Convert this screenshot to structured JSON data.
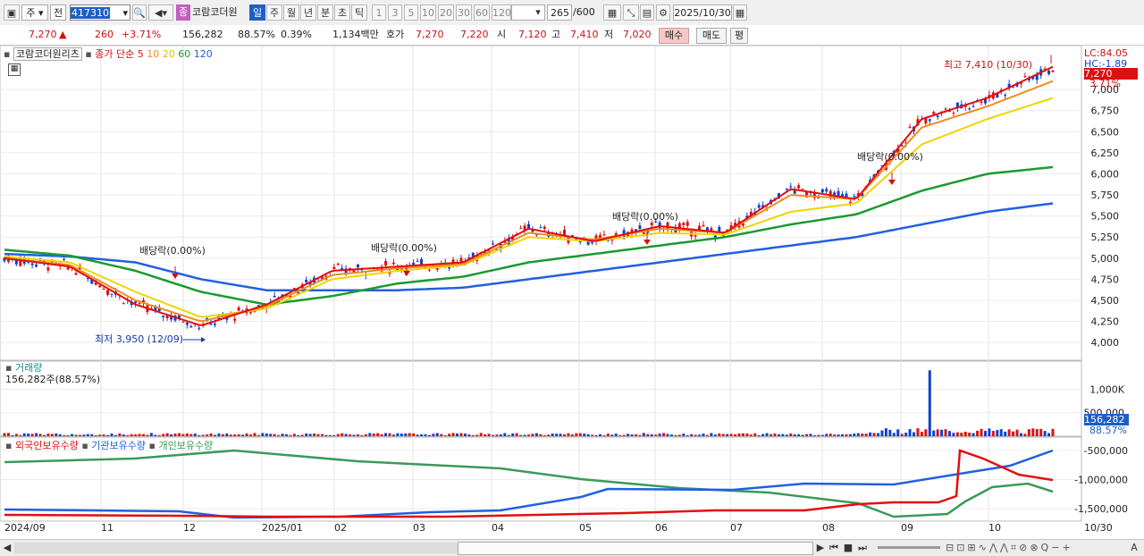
{
  "toolbar": {
    "chart_icon_label": "▣",
    "period_type": "주",
    "prev_label": "전",
    "code": "417310",
    "stock_type_badge": "종",
    "stock_name": "코람코더원",
    "periods": [
      "일",
      "주",
      "월",
      "년",
      "분",
      "초",
      "틱"
    ],
    "active_period": "일",
    "intervals": [
      "1",
      "3",
      "5",
      "10",
      "20",
      "30",
      "60",
      "120"
    ],
    "count_display": "265",
    "count_max": "/600",
    "date": "2025/10/30"
  },
  "quote": {
    "price": "7,270",
    "change_arrow": "▲",
    "change": "260",
    "change_pct": "+3.71%",
    "volume": "156,282",
    "vol_ratio": "88.57%",
    "turnover": "0.39%",
    "amount": "1,134백만",
    "bid_label": "호가",
    "bid1": "7,270",
    "bid2": "7,220",
    "open_label": "시",
    "open": "7,120",
    "high_label": "고",
    "high": "7,410",
    "low_label": "저",
    "low": "7,020",
    "buy_label": "매수",
    "sell_label": "매도",
    "avg_label": "평"
  },
  "legend_main": {
    "name": "코람코더원리츠",
    "price_type": "종가 단순",
    "ma": [
      {
        "label": "5",
        "color": "#e01010"
      },
      {
        "label": "10",
        "color": "#f08c1e"
      },
      {
        "label": "20",
        "color": "#f0d400"
      },
      {
        "label": "60",
        "color": "#1a9a30"
      },
      {
        "label": "120",
        "color": "#2060e0"
      }
    ]
  },
  "annotations": {
    "high": "최고 7,410 (10/30)",
    "low": "최저 3,950 (12/09)",
    "dividends": [
      "배당락(0.00%)",
      "배당락(0.00%)",
      "배당락(0.00%)",
      "배당락(0.00%)"
    ]
  },
  "right_labels": {
    "lc": "LC:84.05",
    "hc": "HC:-1.89",
    "price_tag": "7,270",
    "pct_tag": "3.71%",
    "vol_tag": "156,282",
    "vol_pct_tag": "88.57%"
  },
  "volume_panel": {
    "title": "거래량",
    "value": "156,282주(88.57%)"
  },
  "holders_panel": {
    "series": [
      {
        "name": "외국인보유수량",
        "color": "#e01010"
      },
      {
        "name": "기관보유수량",
        "color": "#2060e0"
      },
      {
        "name": "개인보유수량",
        "color": "#3a9a5a"
      }
    ]
  },
  "x_axis": [
    "2024/09",
    "11",
    "12",
    "2025/01",
    "02",
    "03",
    "04",
    "05",
    "06",
    "07",
    "08",
    "09",
    "10",
    "10/30"
  ],
  "chart_data": [
    {
      "type": "line",
      "panel": "price",
      "x": [
        "2024/09",
        "11",
        "12",
        "2025/01",
        "02",
        "03",
        "04",
        "05",
        "06",
        "07",
        "08",
        "09",
        "10",
        "10/30"
      ],
      "ylim": [
        3800,
        7500
      ],
      "yticks": [
        "4,000",
        "4,250",
        "4,500",
        "4,750",
        "5,000",
        "5,250",
        "5,500",
        "5,750",
        "6,000",
        "6,250",
        "6,500",
        "6,750",
        "7,000"
      ],
      "series": [
        {
          "name": "5",
          "values": [
            5000,
            4900,
            4450,
            4200,
            4450,
            4850,
            4900,
            4950,
            5350,
            5200,
            5380,
            5300,
            5820,
            5700,
            6650,
            6900,
            7270
          ]
        },
        {
          "name": "10",
          "values": [
            5000,
            4920,
            4500,
            4250,
            4430,
            4800,
            4880,
            4930,
            5300,
            5220,
            5350,
            5300,
            5750,
            5700,
            6550,
            6800,
            7100
          ]
        },
        {
          "name": "20",
          "values": [
            5020,
            4950,
            4600,
            4300,
            4400,
            4750,
            4850,
            4920,
            5250,
            5200,
            5300,
            5280,
            5550,
            5650,
            6350,
            6650,
            6900
          ]
        },
        {
          "name": "60",
          "values": [
            5100,
            5030,
            4850,
            4600,
            4450,
            4550,
            4700,
            4780,
            4950,
            5050,
            5150,
            5250,
            5400,
            5520,
            5800,
            6000,
            6080
          ]
        },
        {
          "name": "120",
          "values": [
            5050,
            5020,
            4950,
            4750,
            4620,
            4620,
            4620,
            4650,
            4750,
            4850,
            4950,
            5050,
            5150,
            5250,
            5400,
            5550,
            5650
          ]
        }
      ],
      "high": {
        "value": 7410,
        "date": "10/30"
      },
      "low": {
        "value": 3950,
        "date": "12/09"
      },
      "last": 7270
    },
    {
      "type": "bar",
      "panel": "volume",
      "yticks": [
        "500,000",
        "1,000K"
      ],
      "ylim": [
        0,
        1500000
      ],
      "peak": 1400000,
      "last": 156282
    },
    {
      "type": "line",
      "panel": "holdings",
      "yticks": [
        "-500,000",
        "-1,000,000",
        "-1,500,000"
      ],
      "ylim": [
        -1700000,
        -300000
      ]
    }
  ]
}
